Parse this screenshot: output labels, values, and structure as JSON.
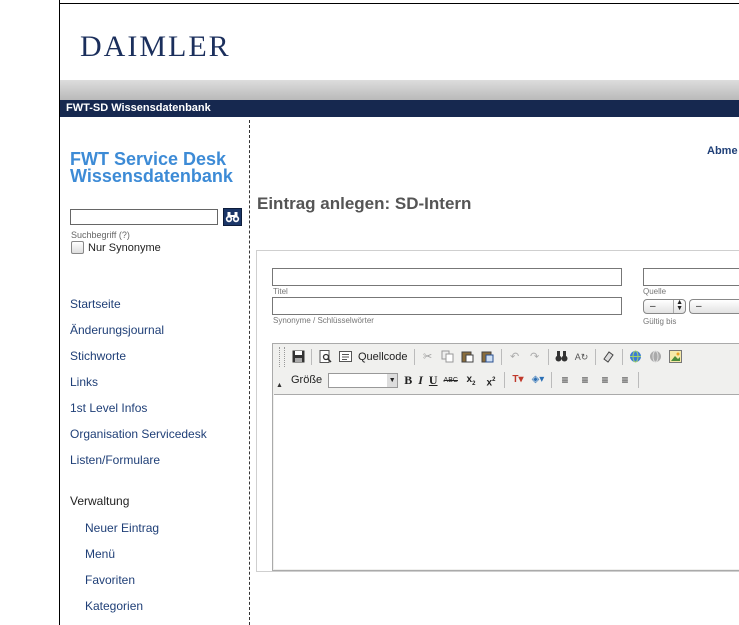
{
  "brand": {
    "logo": "DAIMLER"
  },
  "navbar": {
    "title": "FWT-SD Wissensdatenbank"
  },
  "sidebar": {
    "title": "FWT Service Desk Wissensdatenbank",
    "search": {
      "value": "",
      "hint": "Suchbegriff (?)"
    },
    "synonyms_checkbox": {
      "label": "Nur Synonyme",
      "checked": false
    },
    "items": [
      {
        "label": "Startseite"
      },
      {
        "label": "Änderungsjournal"
      },
      {
        "label": "Stichworte"
      },
      {
        "label": "Links"
      },
      {
        "label": "1st Level Infos"
      },
      {
        "label": "Organisation Servicedesk"
      },
      {
        "label": "Listen/Formulare"
      }
    ],
    "admin": {
      "heading": "Verwaltung",
      "items": [
        {
          "label": "Neuer Eintrag"
        },
        {
          "label": "Menü"
        },
        {
          "label": "Favoriten"
        },
        {
          "label": "Kategorien"
        }
      ]
    }
  },
  "header": {
    "logout_label": "Abme"
  },
  "main": {
    "title": "Eintrag anlegen: SD-Intern",
    "form": {
      "titel": {
        "value": "",
        "label": "Titel"
      },
      "quelle": {
        "value": "",
        "label": "Quelle"
      },
      "synonyme": {
        "value": "",
        "label": "Synonyme / Schlüsselwörter"
      },
      "gueltig_bis": {
        "label": "Gültig bis",
        "select1": "–",
        "select2": "–"
      }
    },
    "editor": {
      "source_label": "Quellcode",
      "size_label": "Größe",
      "size_value": "",
      "format_buttons": [
        "B",
        "I",
        "U",
        "ABC"
      ]
    }
  }
}
